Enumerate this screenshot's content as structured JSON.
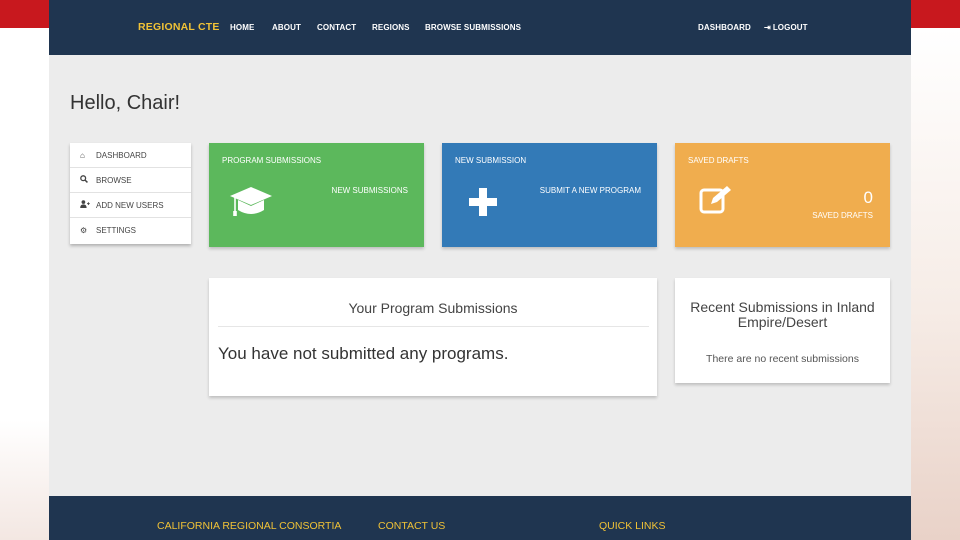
{
  "navbar": {
    "brand": "REGIONAL CTE",
    "links": [
      "HOME",
      "ABOUT",
      "CONTACT",
      "REGIONS",
      "BROWSE SUBMISSIONS"
    ],
    "right_links": {
      "dashboard": "DASHBOARD",
      "logout": "LOGOUT"
    }
  },
  "greeting": "Hello, Chair!",
  "sidemenu": {
    "items": [
      {
        "icon": "home-icon",
        "label": "DASHBOARD"
      },
      {
        "icon": "search-icon",
        "label": "BROWSE"
      },
      {
        "icon": "user-plus-icon",
        "label": "ADD NEW USERS"
      },
      {
        "icon": "gear-icon",
        "label": "SETTINGS"
      }
    ]
  },
  "tiles": {
    "program_submissions": {
      "title": "PROGRAM SUBMISSIONS",
      "subtitle": "NEW SUBMISSIONS",
      "icon": "graduation-cap-icon",
      "color": "#5cb85c"
    },
    "new_submission": {
      "title": "NEW SUBMISSION",
      "subtitle": "SUBMIT A NEW PROGRAM",
      "icon": "plus-icon",
      "color": "#337ab7"
    },
    "saved_drafts": {
      "title": "SAVED DRAFTS",
      "count": "0",
      "count_label": "SAVED DRAFTS",
      "icon": "edit-icon",
      "color": "#f0ad4e"
    }
  },
  "cards": {
    "your_submissions": {
      "title": "Your Program Submissions",
      "body": "You have not submitted any programs."
    },
    "recent": {
      "title": "Recent Submissions in Inland Empire/Desert",
      "body": "There are no recent submissions"
    }
  },
  "footer": {
    "headings": [
      "CALIFORNIA REGIONAL CONSORTIA",
      "CONTACT US",
      "QUICK LINKS"
    ]
  },
  "colors": {
    "navbar": "#1f3550",
    "accent": "#f0c236",
    "slide_red": "#c8181e"
  }
}
